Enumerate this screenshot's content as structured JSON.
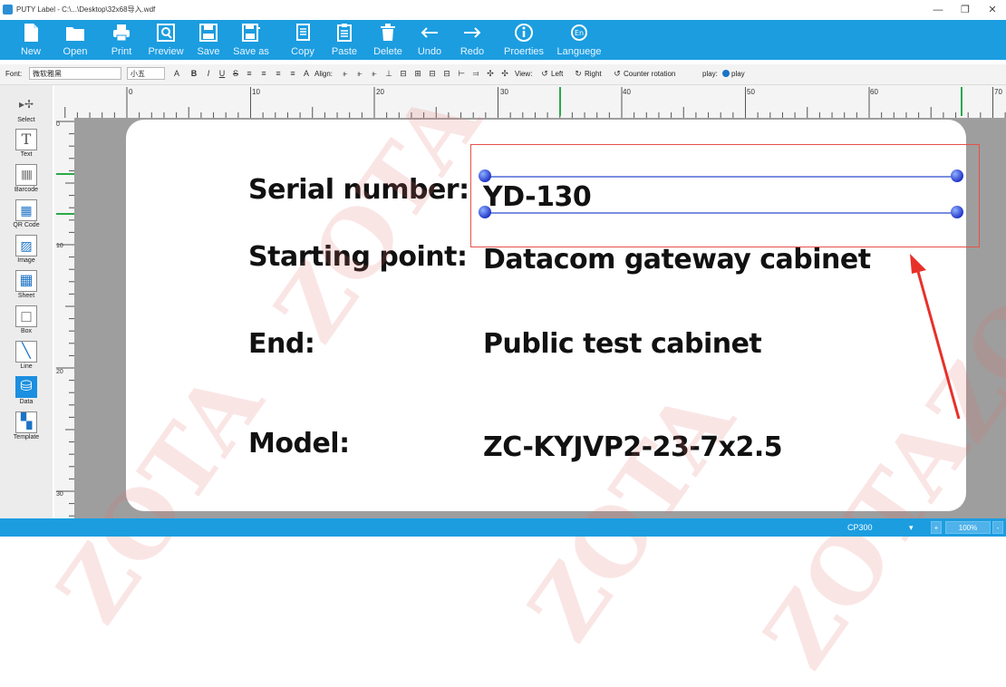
{
  "window": {
    "title": "PUTY Label - C:\\...\\Desktop\\32x68导入.wdf",
    "minimize": "—",
    "maximize": "❐",
    "close": "✕"
  },
  "ribbon": [
    {
      "label": "New",
      "icon": "new-file-icon"
    },
    {
      "label": "Open",
      "icon": "folder-icon"
    },
    {
      "label": "Print",
      "icon": "printer-icon"
    },
    {
      "label": "Preview",
      "icon": "preview-icon"
    },
    {
      "label": "Save",
      "icon": "save-icon"
    },
    {
      "label": "Save as",
      "icon": "save-as-icon"
    },
    {
      "label": "Copy",
      "icon": "copy-icon"
    },
    {
      "label": "Paste",
      "icon": "paste-icon"
    },
    {
      "label": "Delete",
      "icon": "trash-icon"
    },
    {
      "label": "Undo",
      "icon": "arrow-left-icon"
    },
    {
      "label": "Redo",
      "icon": "arrow-right-icon"
    },
    {
      "label": "Proerties",
      "icon": "info-icon"
    },
    {
      "label": "Languege",
      "icon": "language-icon"
    }
  ],
  "format_bar": {
    "font_label": "Font:",
    "font_value": "微软雅黑",
    "size_value": "小五",
    "align_label": "Align:",
    "view_label": "View:",
    "left_label": "Left",
    "right_label": "Right",
    "counter_rotation_label": "Counter rotation",
    "play_label": "play:",
    "play_button": "play"
  },
  "tools": [
    {
      "label": "Select",
      "icon": "select-arrow-icon",
      "glyph": "▸✢"
    },
    {
      "label": "Text",
      "icon": "text-icon",
      "glyph": "T"
    },
    {
      "label": "Barcode",
      "icon": "barcode-icon",
      "glyph": "|||"
    },
    {
      "label": "QR Code",
      "icon": "qr-code-icon",
      "glyph": "▦"
    },
    {
      "label": "Image",
      "icon": "image-icon",
      "glyph": "▨"
    },
    {
      "label": "Sheet",
      "icon": "sheet-icon",
      "glyph": "▦"
    },
    {
      "label": "Box",
      "icon": "box-icon",
      "glyph": "□"
    },
    {
      "label": "Line",
      "icon": "line-icon",
      "glyph": "╲"
    },
    {
      "label": "Data",
      "icon": "database-icon",
      "glyph": "⛁"
    },
    {
      "label": "Template",
      "icon": "template-icon",
      "glyph": "▚"
    }
  ],
  "ruler": {
    "top_marks": [
      "0",
      "10",
      "20",
      "30",
      "40",
      "50",
      "60",
      "70"
    ],
    "left_marks": [
      "0",
      "10",
      "20",
      "30"
    ]
  },
  "label_fields": {
    "serial_label": "Serial number:",
    "serial_value": "YD-130",
    "start_label": "Starting point:",
    "start_value": "Datacom gateway cabinet",
    "end_label": "End:",
    "end_value": "Public test cabinet",
    "model_label": "Model:",
    "model_value": "ZC-KYJVP2-23-7x2.5"
  },
  "watermark": "ZOTA",
  "status": {
    "printer": "CP300",
    "zoom": "100%"
  },
  "colors": {
    "ribbon": "#1b9de0",
    "selection_border": "#e6514a",
    "annotation_arrow": "#e8302a"
  }
}
